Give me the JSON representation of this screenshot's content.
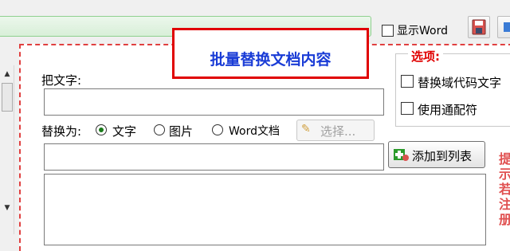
{
  "toolbar": {
    "show_word_label": "显示Word",
    "save_icon": "floppy-disk-icon",
    "extra_icon": "tool-icon"
  },
  "main": {
    "title": "批量替换文档内容",
    "find_label": "把文字:",
    "find_value": "",
    "replace_label": "替换为:",
    "replace_modes": [
      "文字",
      "图片",
      "Word文档"
    ],
    "replace_mode_selected": "文字",
    "select_button": "选择...",
    "replace_value": "",
    "add_button": "添加到列表"
  },
  "options": {
    "title": "选项:",
    "items": [
      {
        "label": "替换域代码文字",
        "checked": false
      },
      {
        "label": "使用通配符",
        "checked": false
      }
    ]
  },
  "side_note": "提示：若注册"
}
